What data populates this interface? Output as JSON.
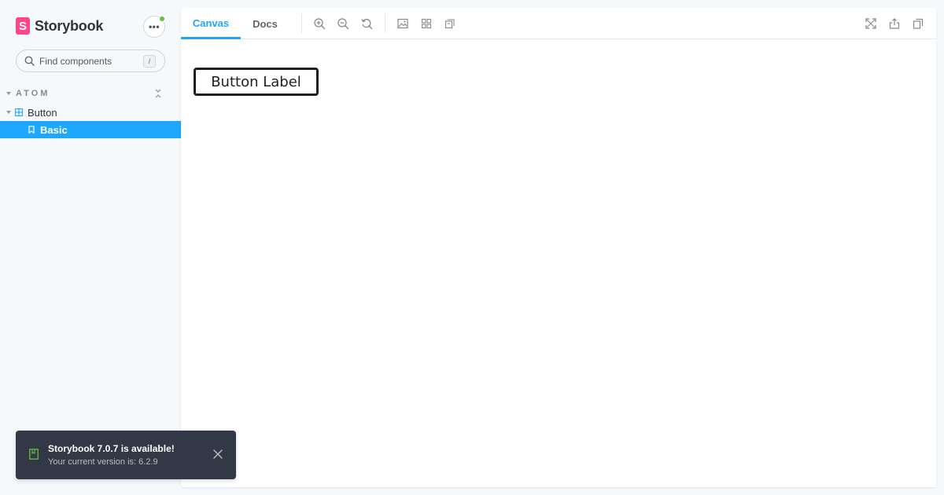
{
  "app": {
    "brand_letter": "S",
    "brand_name": "Storybook"
  },
  "sidebar": {
    "menu_label": "•••",
    "search": {
      "placeholder": "Find components",
      "shortcut": "/"
    },
    "group": {
      "label": "ATOM"
    },
    "component": {
      "label": "Button"
    },
    "stories": [
      {
        "label": "Basic",
        "selected": true
      }
    ]
  },
  "toolbar": {
    "tabs": [
      {
        "label": "Canvas",
        "active": true
      },
      {
        "label": "Docs",
        "active": false
      }
    ],
    "tools_left": [
      "zoom-in-icon",
      "zoom-out-icon",
      "reset-zoom-icon",
      "background-icon",
      "grid-icon",
      "measure-icon"
    ],
    "tools_right": [
      "fullscreen-icon",
      "share-icon",
      "copy-link-icon"
    ]
  },
  "preview": {
    "button_label": "Button Label"
  },
  "toast": {
    "title": "Storybook 7.0.7 is available!",
    "subtitle": "Your current version is: 6.2.9"
  },
  "colors": {
    "accent": "#1ea7fd",
    "brand": "#ff4785",
    "status_dot": "#66bf3c",
    "toast_bg": "#333846"
  }
}
